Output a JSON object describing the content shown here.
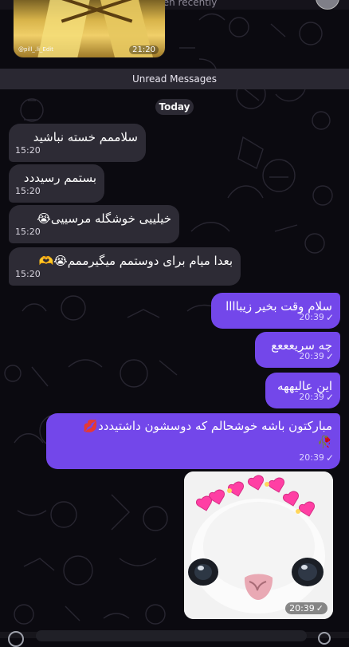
{
  "header": {
    "status": "last seen recently"
  },
  "top_media": {
    "watermark": "@pill_.li_Edit",
    "time": "21:20"
  },
  "divider": {
    "unread_label": "Unread Messages",
    "date_label": "Today"
  },
  "incoming_messages": [
    {
      "text": "سلاممم خسته نباشید",
      "time": "15:20"
    },
    {
      "text": "بستمم رسیددد",
      "time": "15:20"
    },
    {
      "text": "خیلییی خوشگله مرسییی😭",
      "time": "15:20"
    },
    {
      "text": "بعدا میام برای دوستمم میگیرممم😭🫶",
      "time": "15:20"
    }
  ],
  "outgoing_messages": [
    {
      "text": "سلام وقت بخیر زیباااا",
      "time": "20:39"
    },
    {
      "text": "چه سریعععع",
      "time": "20:39"
    },
    {
      "text": "این عالیههه",
      "time": "20:39"
    },
    {
      "line1": "مبارکتون باشه خوشحالم که دوسشون داشتیددد💋",
      "line2": "🥀",
      "time": "20:39"
    }
  ],
  "photo": {
    "time": "20:39"
  },
  "colors": {
    "background": "#0b0a10",
    "incoming_bubble": "#2d2b35",
    "outgoing_bubble": "#7347ea"
  }
}
